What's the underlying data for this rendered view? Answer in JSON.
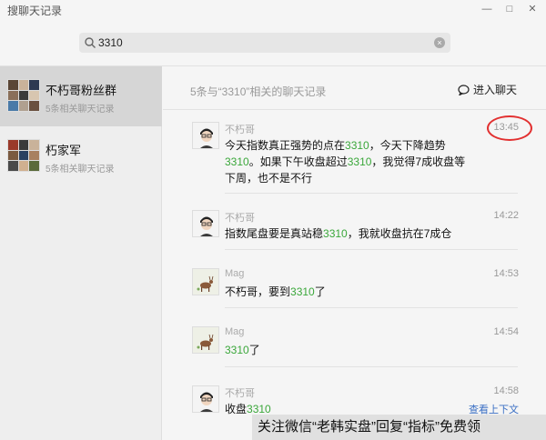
{
  "window": {
    "title": "搜聊天记录",
    "controls": [
      "—",
      "□",
      "✕"
    ]
  },
  "search": {
    "value": "3310"
  },
  "sidebar": {
    "groups": [
      {
        "name": "不朽哥粉丝群",
        "sub": "5条相关聊天记录",
        "active": true
      },
      {
        "name": "朽家军",
        "sub": "5条相关聊天记录",
        "active": false
      }
    ]
  },
  "main": {
    "summary": "5条与“3310”相关的聊天记录",
    "enter_chat": "进入聊天",
    "messages": [
      {
        "sender": "不朽哥",
        "time": "13:45",
        "avatar": "person",
        "parts": [
          "今天指数真正强势的点在",
          "3310",
          "，今天下降趋势",
          "3310",
          "。如果下午收盘超过",
          "3310",
          "，我觉得7成收盘等下周，也不是不行"
        ]
      },
      {
        "sender": "不朽哥",
        "time": "14:22",
        "avatar": "person",
        "parts": [
          "指数尾盘要是真站稳",
          "3310",
          "，我就收盘抗在7成仓"
        ]
      },
      {
        "sender": "Mag",
        "time": "14:53",
        "avatar": "deer",
        "parts": [
          "不朽哥，要到",
          "3310",
          "了"
        ]
      },
      {
        "sender": "Mag",
        "time": "14:54",
        "avatar": "deer",
        "parts": [
          "",
          "3310",
          "了"
        ]
      },
      {
        "sender": "不朽哥",
        "time": "14:58",
        "avatar": "person",
        "parts": [
          "收盘",
          "3310",
          ""
        ],
        "context_link": "查看上下文"
      }
    ]
  },
  "banner": {
    "text": "关注微信“老韩实盘”回复“指标”免费领"
  },
  "colors": {
    "highlight": "#3aa73a",
    "annotation": "#e23030",
    "link": "#3a6fc4"
  }
}
